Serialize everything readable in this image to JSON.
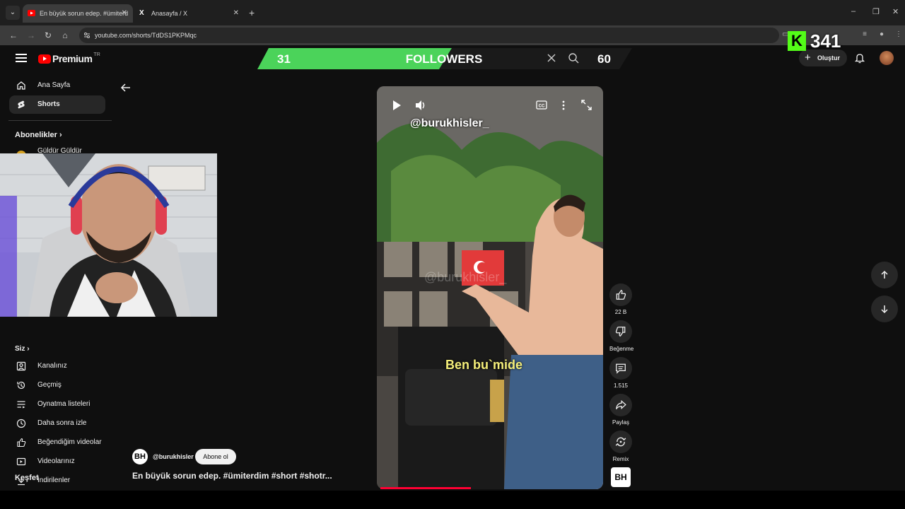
{
  "browser": {
    "tabs": [
      {
        "title": "En büyük sorun edep. #ümiterd",
        "active": true
      },
      {
        "title": "Anasayfa / X",
        "active": false
      }
    ],
    "url": "youtube.com/shorts/TdDS1PKPMqc"
  },
  "youtube": {
    "logo_text": "Premium",
    "region": "TR",
    "create_label": "Oluştur"
  },
  "sidebar": {
    "items": [
      {
        "label": "Ana Sayfa",
        "icon": "home-icon"
      },
      {
        "label": "Shorts",
        "icon": "shorts-icon"
      }
    ],
    "subscriptions_title": "Abonelikler",
    "partial_sub": "Güldür Güldür",
    "you_title": "Siz",
    "you_items": [
      {
        "label": "Kanalınız",
        "icon": "channel-icon"
      },
      {
        "label": "Geçmiş",
        "icon": "history-icon"
      },
      {
        "label": "Oynatma listeleri",
        "icon": "playlist-icon"
      },
      {
        "label": "Daha sonra izle",
        "icon": "clock-icon"
      },
      {
        "label": "Beğendiğim videolar",
        "icon": "thumb-up-icon"
      },
      {
        "label": "Videolarınız",
        "icon": "video-icon"
      },
      {
        "label": "İndirilenler",
        "icon": "download-icon"
      }
    ],
    "explore_title": "Keşfet"
  },
  "overlay": {
    "followers_current": "31",
    "followers_label": "FOLLOWERS",
    "followers_goal": "60",
    "followers_progress": 0.52,
    "kick_count": "341",
    "kick_logo": "K",
    "colors": {
      "kick_green": "#53fc18"
    }
  },
  "player": {
    "handle": "@burukhisler_",
    "watermark": "@burukhisler_",
    "subtitle": "Ben bu`mide",
    "progress": 0.4
  },
  "actions": {
    "like_count": "22 B",
    "dislike_label": "Beğenme",
    "comment_count": "1.515",
    "share_label": "Paylaş",
    "remix_label": "Remix"
  },
  "channel": {
    "avatar_text": "BH",
    "name": "@burukhisler",
    "subscribe_label": "Abone ol",
    "video_title": "En büyük sorun edep. #ümiterdim #short #shotr..."
  }
}
